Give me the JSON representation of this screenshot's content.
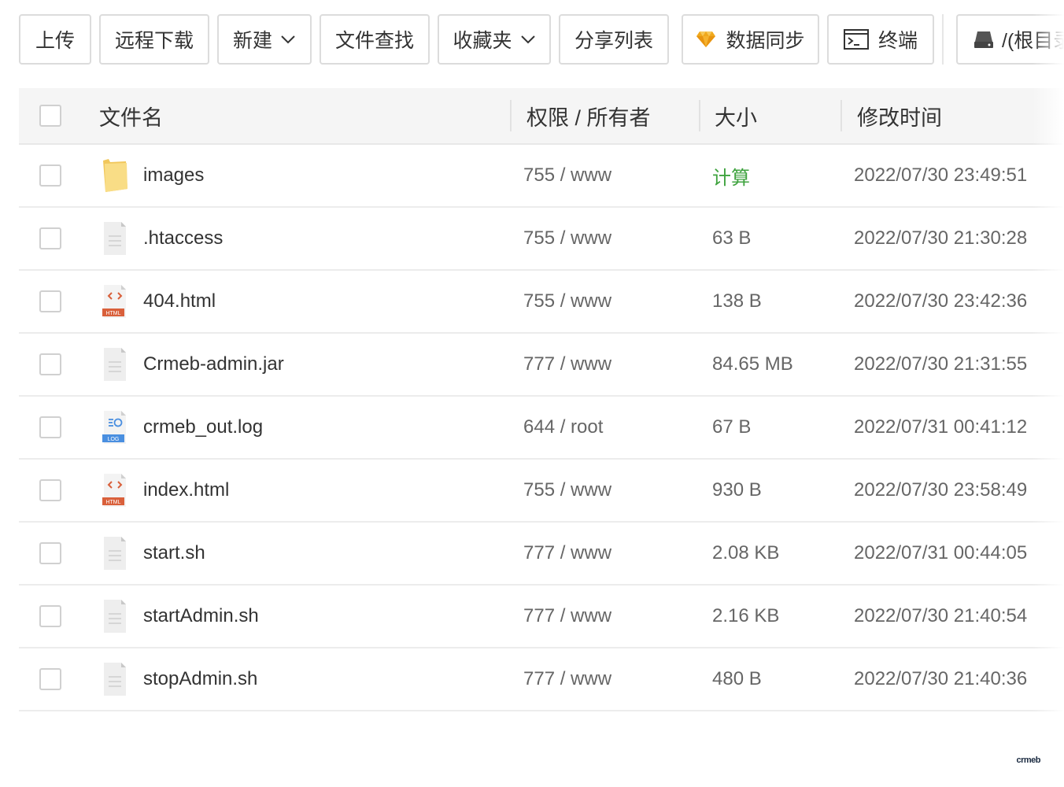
{
  "toolbar": {
    "upload": "上传",
    "remote_download": "远程下载",
    "new": "新建",
    "file_search": "文件查找",
    "favorites": "收藏夹",
    "share_list": "分享列表",
    "data_sync": "数据同步",
    "terminal": "终端",
    "path": "/(根目录"
  },
  "table": {
    "headers": {
      "name": "文件名",
      "perm": "权限 / 所有者",
      "size": "大小",
      "mtime": "修改时间"
    },
    "rows": [
      {
        "name": "images",
        "perm": "755 / www",
        "size": "计算",
        "mtime": "2022/07/30 23:49:51",
        "icon": "folder-icon"
      },
      {
        "name": ".htaccess",
        "perm": "755 / www",
        "size": "63 B",
        "mtime": "2022/07/30 21:30:28",
        "icon": "file-icon"
      },
      {
        "name": "404.html",
        "perm": "755 / www",
        "size": "138 B",
        "mtime": "2022/07/30 23:42:36",
        "icon": "html-file-icon"
      },
      {
        "name": "Crmeb-admin.jar",
        "perm": "777 / www",
        "size": "84.65 MB",
        "mtime": "2022/07/30 21:31:55",
        "icon": "file-icon"
      },
      {
        "name": "crmeb_out.log",
        "perm": "644 / root",
        "size": "67 B",
        "mtime": "2022/07/31 00:41:12",
        "icon": "log-file-icon"
      },
      {
        "name": "index.html",
        "perm": "755 / www",
        "size": "930 B",
        "mtime": "2022/07/30 23:58:49",
        "icon": "html-file-icon"
      },
      {
        "name": "start.sh",
        "perm": "777 / www",
        "size": "2.08 KB",
        "mtime": "2022/07/31 00:44:05",
        "icon": "file-icon"
      },
      {
        "name": "startAdmin.sh",
        "perm": "777 / www",
        "size": "2.16 KB",
        "mtime": "2022/07/30 21:40:54",
        "icon": "file-icon"
      },
      {
        "name": "stopAdmin.sh",
        "perm": "777 / www",
        "size": "480 B",
        "mtime": "2022/07/30 21:40:36",
        "icon": "file-icon"
      }
    ]
  },
  "icon_labels": {
    "html": "HTML",
    "log": "LOG"
  },
  "watermark": "crmeb",
  "colors": {
    "calc_green": "#3fa33f",
    "folder_yellow": "#f7d774",
    "html_orange": "#d9603b",
    "log_blue": "#4a8fe0",
    "diamond_gold": "#f0a81c"
  }
}
